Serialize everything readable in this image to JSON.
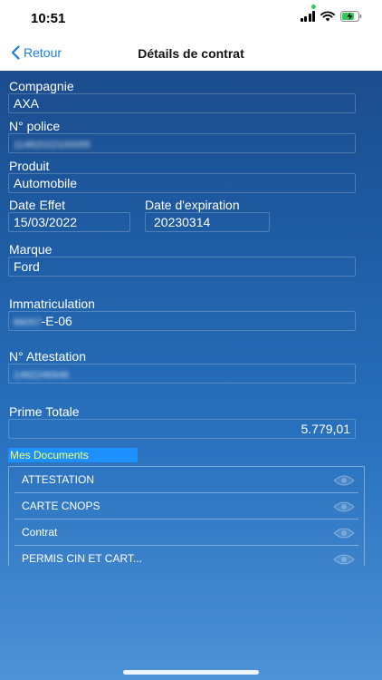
{
  "status": {
    "time": "10:51"
  },
  "nav": {
    "back_label": "Retour",
    "title": "Détails de contrat"
  },
  "fields": {
    "compagnie": {
      "label": "Compagnie",
      "value": "AXA"
    },
    "police": {
      "label": "N° police",
      "value": "11482022100095"
    },
    "produit": {
      "label": "Produit",
      "value": "Automobile"
    },
    "date_effet": {
      "label": "Date Effet",
      "value": "15/03/2022"
    },
    "date_expiration": {
      "label": "Date d'expiration",
      "value": "20230314"
    },
    "marque": {
      "label": "Marque",
      "value": "Ford"
    },
    "immatriculation": {
      "label": "Immatriculation",
      "value_hidden": "88057",
      "value_visible": "-E-06"
    },
    "attestation": {
      "label": "N° Attestation",
      "value": "1482246946"
    },
    "prime": {
      "label": "Prime Totale",
      "value": "5.779,01"
    }
  },
  "documents": {
    "title": "Mes Documents",
    "items": [
      {
        "label": "ATTESTATION",
        "icon": "eye-icon"
      },
      {
        "label": "CARTE CNOPS",
        "icon": "eye-icon"
      },
      {
        "label": "Contrat",
        "icon": "eye-icon"
      },
      {
        "label": "PERMIS CIN ET CART...",
        "icon": "eye-icon"
      }
    ]
  },
  "colors": {
    "accent": "#1a7cf5",
    "background_top": "#1b4c8d",
    "background_bottom": "#4e92d6",
    "docs_title_bg": "#1e90ff",
    "docs_title_text": "#f5ff66"
  }
}
